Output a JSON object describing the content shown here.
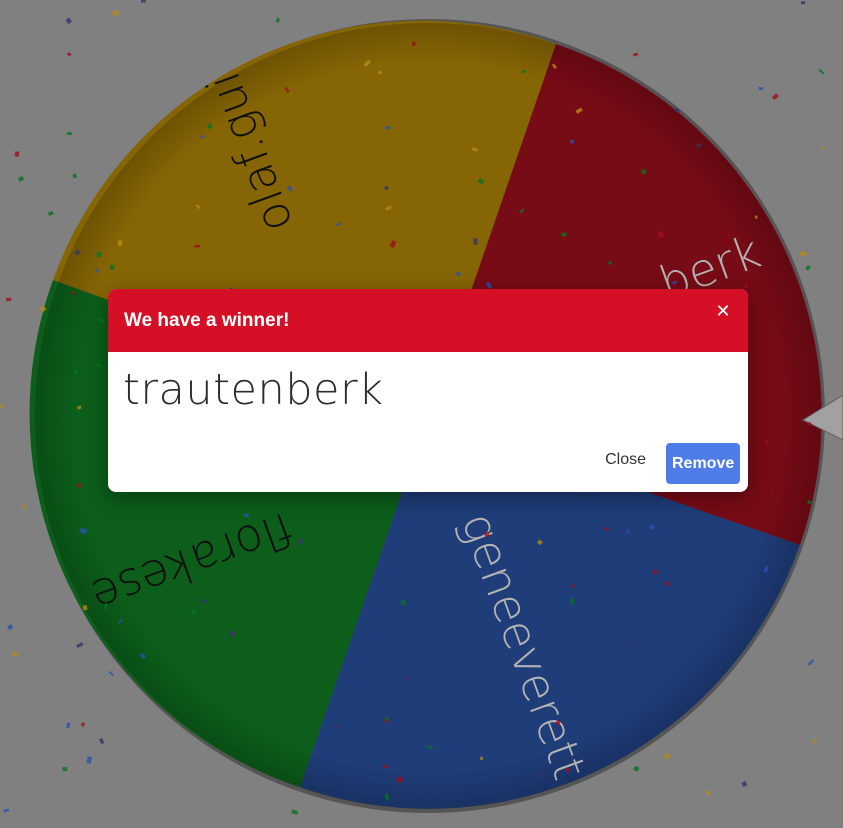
{
  "wheel": {
    "segments": [
      {
        "label": "olaf.gui",
        "color": "#ae8100"
      },
      {
        "label": "trautenberk",
        "color": "#9e0c1c"
      },
      {
        "label": "geneeverett",
        "color": "#264ea0"
      },
      {
        "label": "florakese",
        "color": "#0b7a1e"
      }
    ],
    "visible_text": {
      "olaf": "olaf.gui",
      "berk": "berk",
      "geneeverett": "geneeverett",
      "florakese": "florakese"
    },
    "pointer_color": "#cfcfcf"
  },
  "dialog": {
    "title": "We have a winner!",
    "close_x": "✕",
    "winner": "trautenberk",
    "close_label": "Close",
    "remove_label": "Remove",
    "header_color": "#d50f25",
    "remove_color": "#4f7de8"
  }
}
